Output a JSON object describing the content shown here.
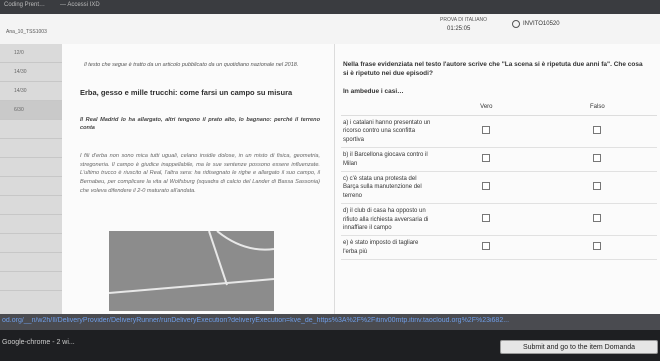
{
  "browser": {
    "tab1": "Coding Prent…",
    "tab2": "— Accessi IXD"
  },
  "header": {
    "subtitle": "Ana_10_TSS1003",
    "timer_label": "PROVA DI ITALIANO",
    "timer_value": "01:25:05",
    "user": "INVITO10520"
  },
  "sidebar": {
    "items": [
      "12/0",
      "14/30",
      "14/30",
      "6/30",
      "",
      "",
      "",
      "",
      "",
      "",
      "",
      "",
      ""
    ]
  },
  "article": {
    "intro": "Il testo che segue è tratto da un articolo pubblicato da un quotidiano nazionale nel 2018.",
    "title": "Erba, gesso e mille trucchi: come farsi un campo su misura",
    "lead": "Il Real Madrid lo ha allargato, altri tengono il prato alto, lo bagnano: perché il terreno conta",
    "body": "I fili d'erba non sono mica tutti uguali, celano insidie dolose, in un misto di fisica, geometria, stregoneria. Il campo è giudice inappellabile, ma le sue sentenze possono essere influenzate. L'ultimo trucco è riuscito al Real, l'altra sera: ha ridisegnato le righe e allargato il suo campo, il Bernabeu, per complicare la vita al Wolfsburg (squadra di calcio del Lander di Bassa Sassonia) che voleva difendere il 2-0 maturato all'andata."
  },
  "question": {
    "text": "Nella frase evidenziata nel testo l'autore scrive che \"La scena si è ripetuta due anni fa\". Che cosa si è ripetuto nei due episodi?",
    "sub": "In ambedue i casi…",
    "col_true": "Vero",
    "col_false": "Falso",
    "options": [
      "a) i catalani hanno presentato un ricorso contro una sconfitta sportiva",
      "b) il Barcellona giocava contro il Milan",
      "c) c'è stata una protesta del Barça sulla manutenzione del terreno",
      "d) il club di casa ha opposto un rifiuto alla richiesta avversaria di innaffiare il campo",
      "e) è stato imposto di tagliare l'erba più"
    ]
  },
  "status": {
    "url": "od.org/__n/w2h/Il/DeliveryProvider/DeliveryRunner/runDeliveryExecution?deliveryExecution=kve_de_https%3A%2F%2Fitinv00mtp.itinv.taocloud.org%2F%23i682..."
  },
  "footer": {
    "app": "Google-chrome - 2 wi...",
    "submit": "Submit and go to the item Domanda"
  }
}
